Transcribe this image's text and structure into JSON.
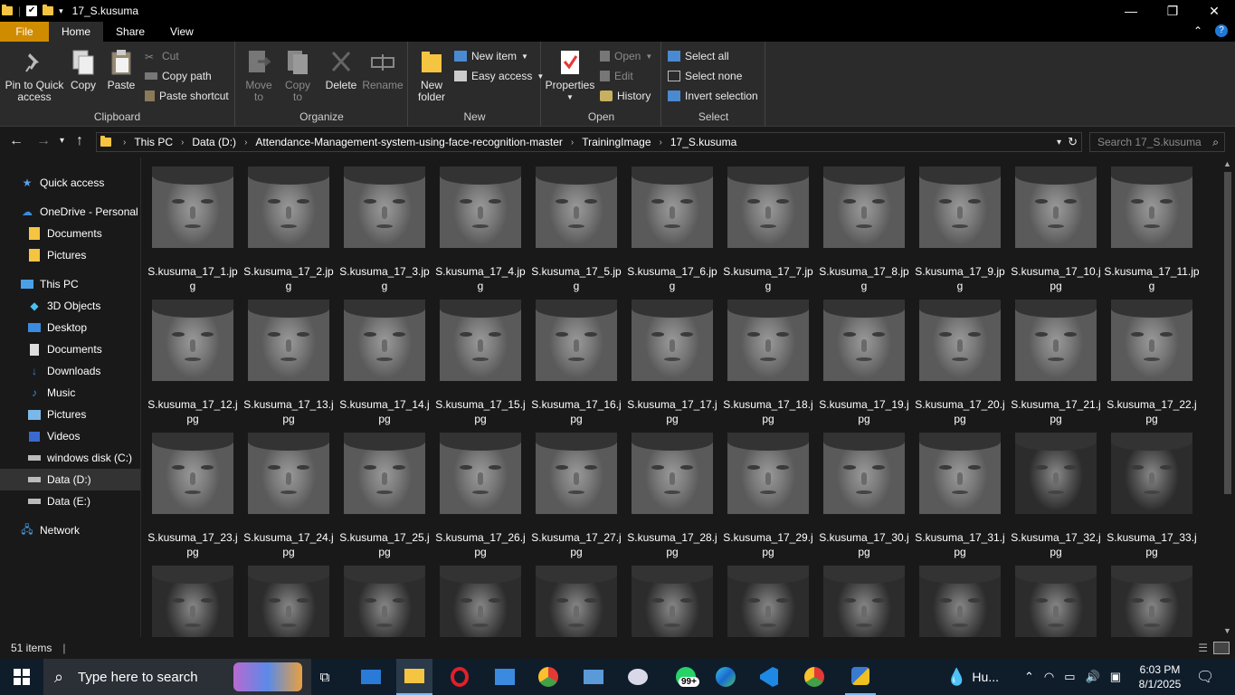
{
  "window": {
    "title": "17_S.kusuma"
  },
  "tabs": [
    "File",
    "Home",
    "Share",
    "View"
  ],
  "ribbon": {
    "clipboard": {
      "label": "Clipboard",
      "pin": "Pin to Quick access",
      "copy": "Copy",
      "paste": "Paste",
      "cut": "Cut",
      "copy_path": "Copy path",
      "paste_shortcut": "Paste shortcut"
    },
    "organize": {
      "label": "Organize",
      "move_to": "Move to",
      "copy_to": "Copy to",
      "delete": "Delete",
      "rename": "Rename"
    },
    "new": {
      "label": "New",
      "new_folder": "New folder",
      "new_item": "New item",
      "easy_access": "Easy access"
    },
    "open": {
      "label": "Open",
      "properties": "Properties",
      "open": "Open",
      "edit": "Edit",
      "history": "History"
    },
    "select": {
      "label": "Select",
      "select_all": "Select all",
      "select_none": "Select none",
      "invert": "Invert selection"
    }
  },
  "breadcrumb": [
    "This PC",
    "Data (D:)",
    "Attendance-Management-system-using-face-recognition-master",
    "TrainingImage",
    "17_S.kusuma"
  ],
  "search": {
    "placeholder": "Search 17_S.kusuma"
  },
  "nav": [
    {
      "label": "Quick access",
      "icon": "star-icon"
    },
    {
      "label": "OneDrive - Personal",
      "icon": "cloud-icon"
    },
    {
      "label": "Documents",
      "icon": "folder-icon"
    },
    {
      "label": "Pictures",
      "icon": "folder-icon"
    },
    {
      "label": "This PC",
      "icon": "computer-icon"
    },
    {
      "label": "3D Objects",
      "icon": "cube-icon"
    },
    {
      "label": "Desktop",
      "icon": "desktop-icon"
    },
    {
      "label": "Documents",
      "icon": "document-icon"
    },
    {
      "label": "Downloads",
      "icon": "download-icon"
    },
    {
      "label": "Music",
      "icon": "music-icon"
    },
    {
      "label": "Pictures",
      "icon": "pictures-icon"
    },
    {
      "label": "Videos",
      "icon": "video-icon"
    },
    {
      "label": "windows disk (C:)",
      "icon": "drive-icon"
    },
    {
      "label": "Data (D:)",
      "icon": "drive-icon"
    },
    {
      "label": "Data  (E:)",
      "icon": "drive-icon"
    },
    {
      "label": "Network",
      "icon": "network-icon"
    }
  ],
  "files": [
    "S.kusuma_17_1.jpg",
    "S.kusuma_17_2.jpg",
    "S.kusuma_17_3.jpg",
    "S.kusuma_17_4.jpg",
    "S.kusuma_17_5.jpg",
    "S.kusuma_17_6.jpg",
    "S.kusuma_17_7.jpg",
    "S.kusuma_17_8.jpg",
    "S.kusuma_17_9.jpg",
    "S.kusuma_17_10.jpg",
    "S.kusuma_17_11.jpg",
    "S.kusuma_17_12.jpg",
    "S.kusuma_17_13.jpg",
    "S.kusuma_17_14.jpg",
    "S.kusuma_17_15.jpg",
    "S.kusuma_17_16.jpg",
    "S.kusuma_17_17.jpg",
    "S.kusuma_17_18.jpg",
    "S.kusuma_17_19.jpg",
    "S.kusuma_17_20.jpg",
    "S.kusuma_17_21.jpg",
    "S.kusuma_17_22.jpg",
    "S.kusuma_17_23.jpg",
    "S.kusuma_17_24.jpg",
    "S.kusuma_17_25.jpg",
    "S.kusuma_17_26.jpg",
    "S.kusuma_17_27.jpg",
    "S.kusuma_17_28.jpg",
    "S.kusuma_17_29.jpg",
    "S.kusuma_17_30.jpg",
    "S.kusuma_17_31.jpg",
    "S.kusuma_17_32.jpg",
    "S.kusuma_17_33.jpg",
    "",
    "",
    "",
    "",
    "",
    "",
    "",
    "",
    "",
    "",
    ""
  ],
  "status": {
    "item_count": "51 items"
  },
  "taskbar": {
    "search_placeholder": "Type here to search",
    "whatsapp_badge": "99+",
    "weather": "Hu...",
    "time": "6:03 PM",
    "date": "8/1/2025"
  }
}
